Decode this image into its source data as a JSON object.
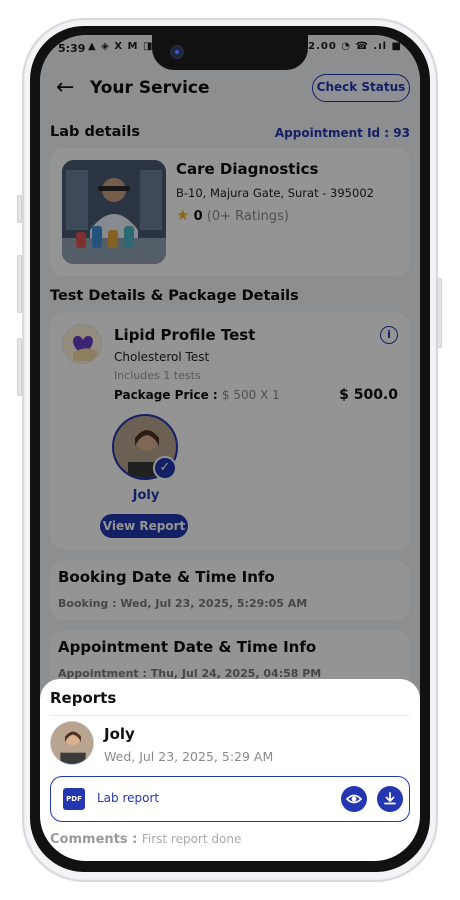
{
  "status_bar": {
    "time": "5:39",
    "left_icons": "▲ ◈ X M ◨",
    "right_text": "2.00 ◔ ☎ .ıl ■"
  },
  "appbar": {
    "title": "Your Service",
    "check_status_label": "Check Status"
  },
  "lab_section": {
    "title": "Lab details",
    "appointment_id": "Appointment Id : 93",
    "lab_name": "Care Diagnostics",
    "address": "B-10, Majura Gate, Surat - 395002",
    "rating_value": "0",
    "rating_count": "(0+ Ratings)"
  },
  "test_section": {
    "title": "Test Details & Package Details",
    "package_name": "Lipid Profile Test",
    "test_name": "Cholesterol Test",
    "includes": "Includes 1 tests",
    "price_label": "Package Price :",
    "price_detail": "$ 500 X 1",
    "total": "$ 500.0",
    "patient_name": "Joly",
    "view_report_label": "View Report"
  },
  "booking_info": {
    "title": "Booking Date & Time Info",
    "line": "Booking : Wed, Jul 23, 2025, 5:29:05 AM"
  },
  "appointment_info": {
    "title": "Appointment Date & Time Info",
    "line": "Appointment : Thu, Jul 24, 2025, 04:58 PM"
  },
  "reports_sheet": {
    "title": "Reports",
    "patient_name": "Joly",
    "date": "Wed, Jul 23, 2025, 5:29 AM",
    "report_label": "Lab report",
    "pdf_icon_text": "PDF",
    "comments_label": "Comments :",
    "comments_value": "First report done"
  },
  "icons": {
    "back": "arrow-left-icon",
    "info": "info-icon",
    "star": "star-icon",
    "check": "check-icon",
    "pdf": "pdf-icon",
    "view": "eye-icon",
    "download": "download-icon"
  },
  "colors": {
    "primary": "#2437b0",
    "star": "#f0b429",
    "overlay": "rgba(0,0,0,0.42)"
  }
}
